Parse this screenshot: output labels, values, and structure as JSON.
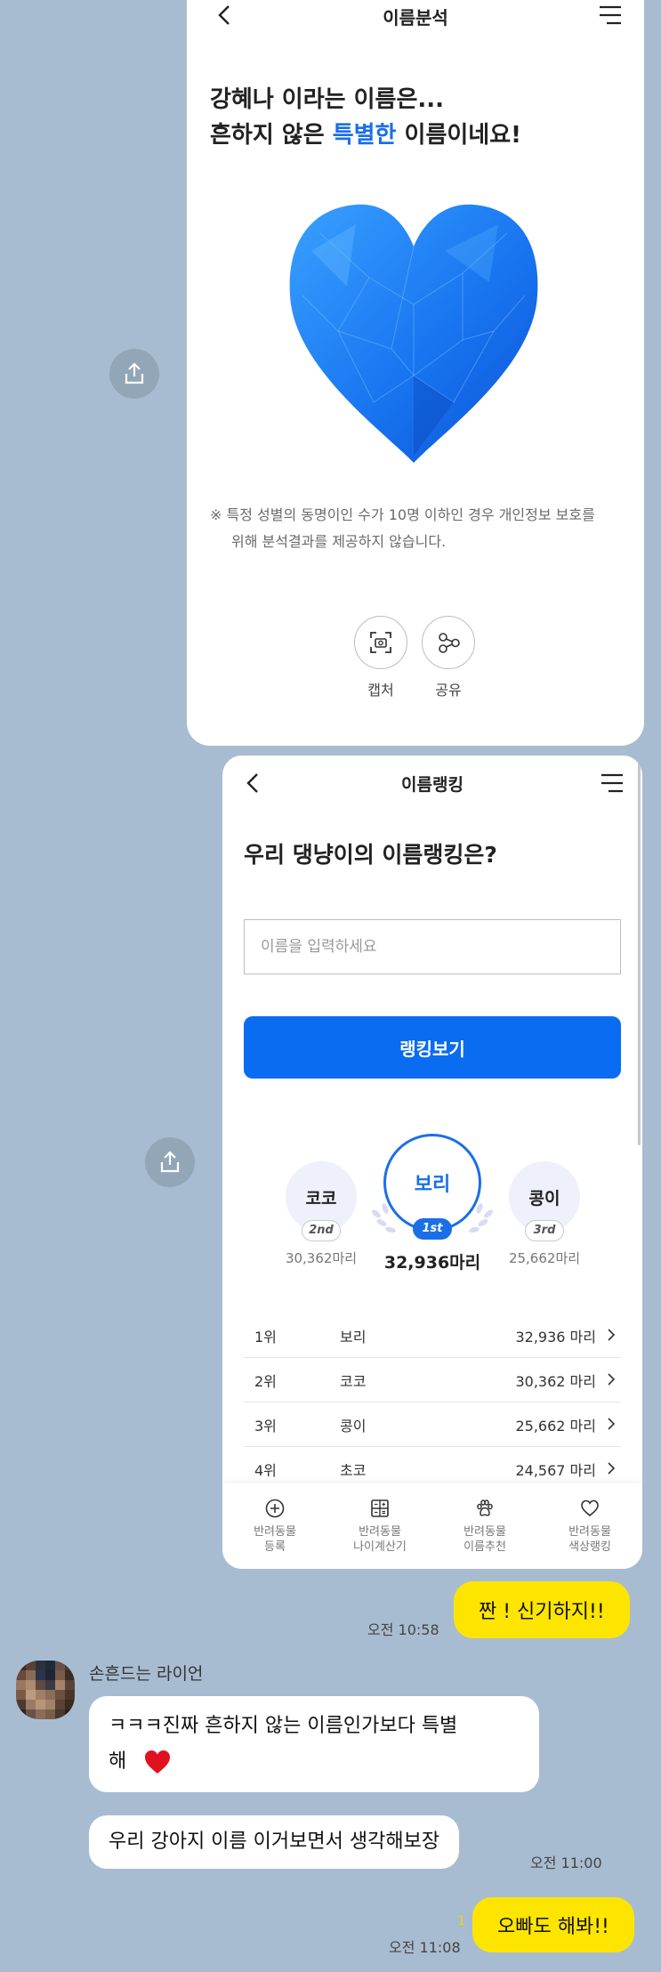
{
  "card1": {
    "title": "이름분석",
    "headline_line1": "강혜나 이라는 이름은...",
    "headline_line2_pre": "흔하지 않은 ",
    "headline_line2_highlight": "특별한",
    "headline_line2_post": " 이름이네요!",
    "notice_line1": "※ 특정 성별의 동명이인 수가 10명 이하인 경우 개인정보 보호를",
    "notice_line2": "위해 분석결과를 제공하지 않습니다.",
    "capture_label": "캡처",
    "share_label": "공유",
    "heart_color": "#1f7bf2"
  },
  "card2": {
    "title": "이름랭킹",
    "question": "우리 댕냥이의 이름랭킹은?",
    "input_placeholder": "이름을 입력하세요",
    "button_label": "랭킹보기",
    "podium": {
      "second": {
        "name": "코코",
        "place": "2nd",
        "count": "30,362마리"
      },
      "first": {
        "name": "보리",
        "place": "1st",
        "count": "32,936마리"
      },
      "third": {
        "name": "콩이",
        "place": "3rd",
        "count": "25,662마리"
      }
    },
    "rows": [
      {
        "rank": "1위",
        "name": "보리",
        "count": "32,936 마리"
      },
      {
        "rank": "2위",
        "name": "코코",
        "count": "30,362 마리"
      },
      {
        "rank": "3위",
        "name": "콩이",
        "count": "25,662 마리"
      },
      {
        "rank": "4위",
        "name": "초코",
        "count": "24,567 마리"
      }
    ],
    "nav": [
      {
        "line1": "반려동물",
        "line2": "등록",
        "icon": "plus-circle-icon"
      },
      {
        "line1": "반려동물",
        "line2": "나이계산기",
        "icon": "calculator-icon"
      },
      {
        "line1": "반려동물",
        "line2": "이름추천",
        "icon": "paw-icon"
      },
      {
        "line1": "반려동물",
        "line2": "색상랭킹",
        "icon": "heart-icon"
      }
    ]
  },
  "chat": {
    "msg1": {
      "text": "짠 ! 신기하지!!",
      "time": "오전 10:58"
    },
    "sender_name": "손흔드는 라이언",
    "msg2_line1": "ㅋㅋㅋ진짜 흔하지 않는 이름인가보다 특별",
    "msg2_line2": "해",
    "msg3": {
      "text": "우리 강아지 이름 이거보면서 생각해보장",
      "time": "오전 11:00"
    },
    "msg4": {
      "text": "오빠도 해봐!!",
      "time": "오전 11:08",
      "unread": "1"
    },
    "my_bubble_color": "#fee500",
    "chat_bg_color": "#a8bcd1"
  }
}
